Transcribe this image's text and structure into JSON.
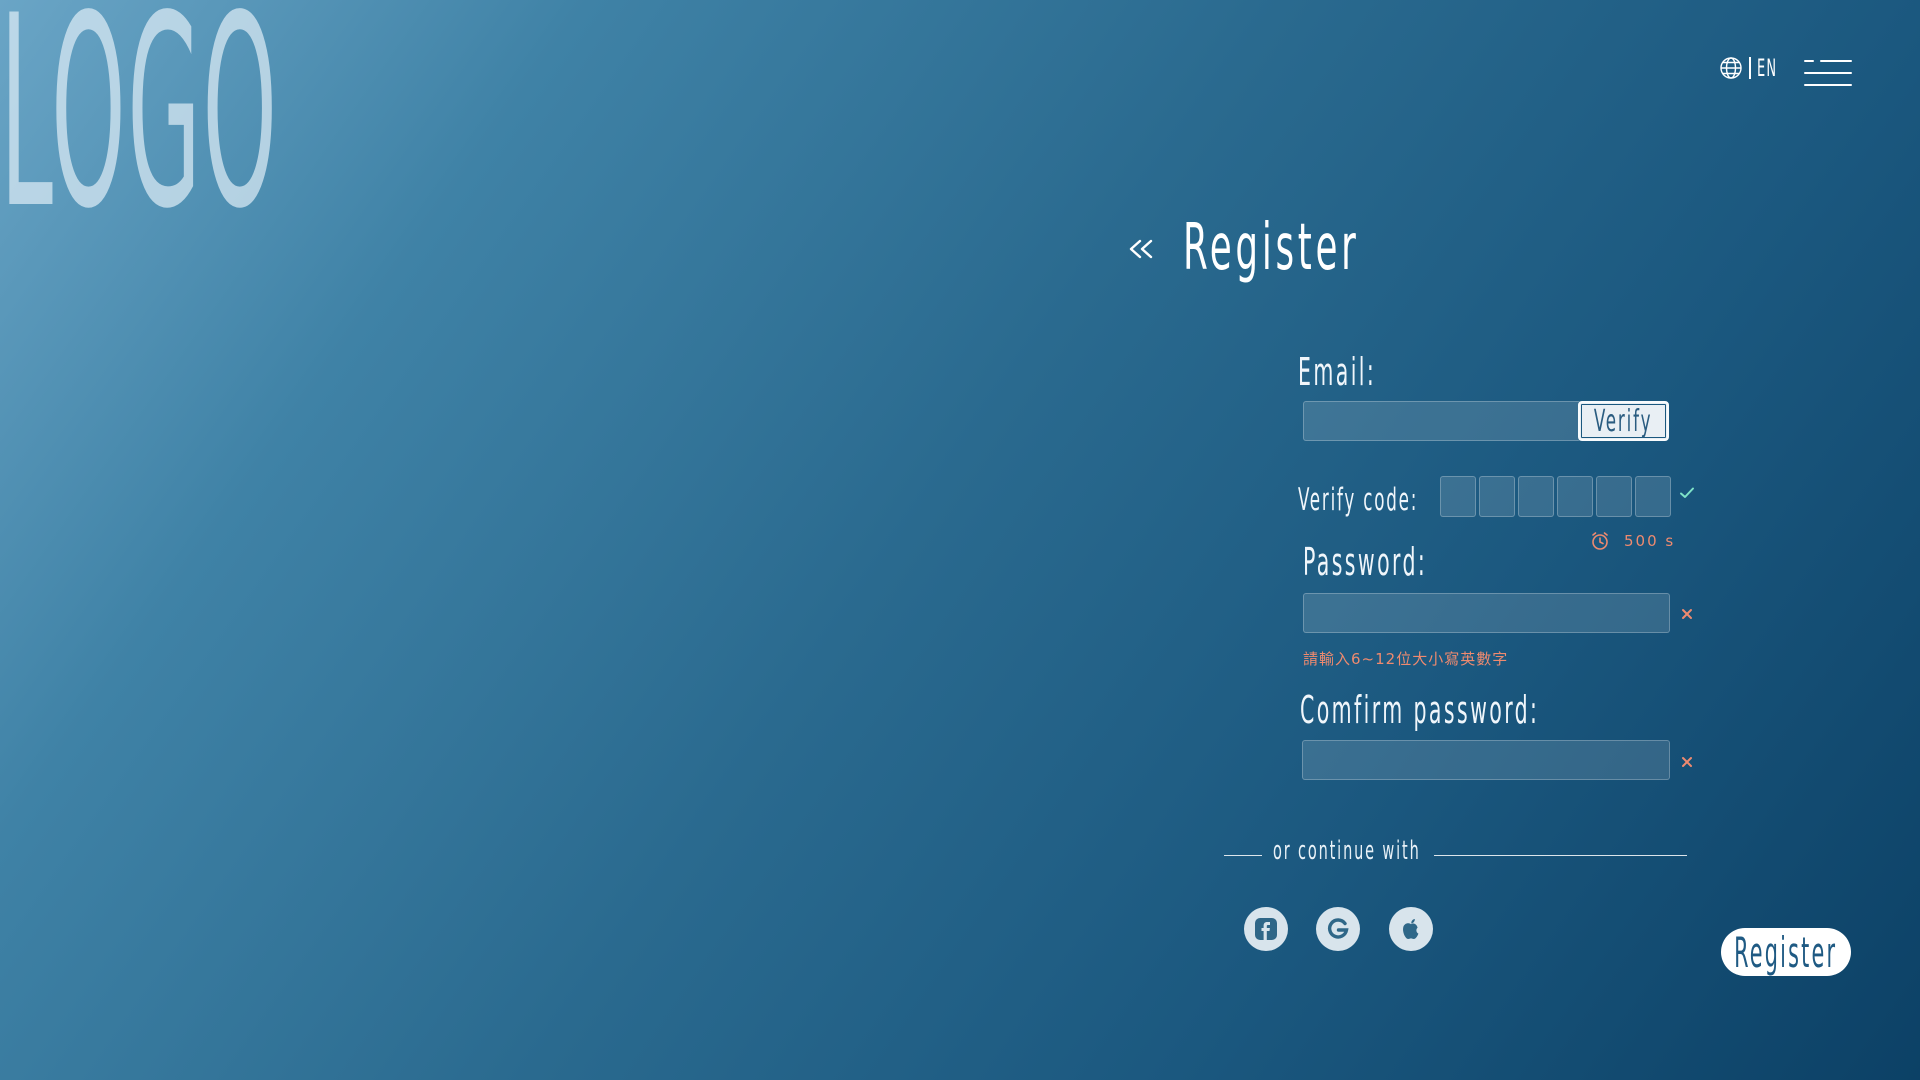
{
  "logo": {
    "text": "LOGO"
  },
  "header": {
    "language_code": "EN",
    "language_icon": "globe-icon",
    "menu_icon": "hamburger-menu-icon"
  },
  "page": {
    "back_icon": "double-chevron-left-icon",
    "title": "Register"
  },
  "form": {
    "email_label": "Email:",
    "email_value": "",
    "verify_button": "Verify",
    "verify_code_label": "Verify code:",
    "verify_code_digits": [
      "",
      "",
      "",
      "",
      "",
      ""
    ],
    "verify_status_icon": "check-icon",
    "countdown_icon": "alarm-clock-icon",
    "countdown_text": "500 s",
    "password_label": "Password:",
    "password_value": "",
    "password_error_icon": "close-icon",
    "password_hint": "請輸入6~12位大小寫英數字",
    "confirm_password_label": "Comfirm password:",
    "confirm_password_value": "",
    "confirm_password_error_icon": "close-icon"
  },
  "social": {
    "divider_text": "or continue with",
    "providers": [
      {
        "name": "facebook",
        "icon": "facebook-icon"
      },
      {
        "name": "google",
        "icon": "google-icon"
      },
      {
        "name": "apple",
        "icon": "apple-icon"
      }
    ]
  },
  "actions": {
    "register_button": "Register"
  },
  "colors": {
    "background_start": "#6aa5c6",
    "background_end": "#0c4166",
    "error_accent": "#ee8a6f",
    "success_accent": "#7fe3c8",
    "button_text": "#1f5a83"
  }
}
